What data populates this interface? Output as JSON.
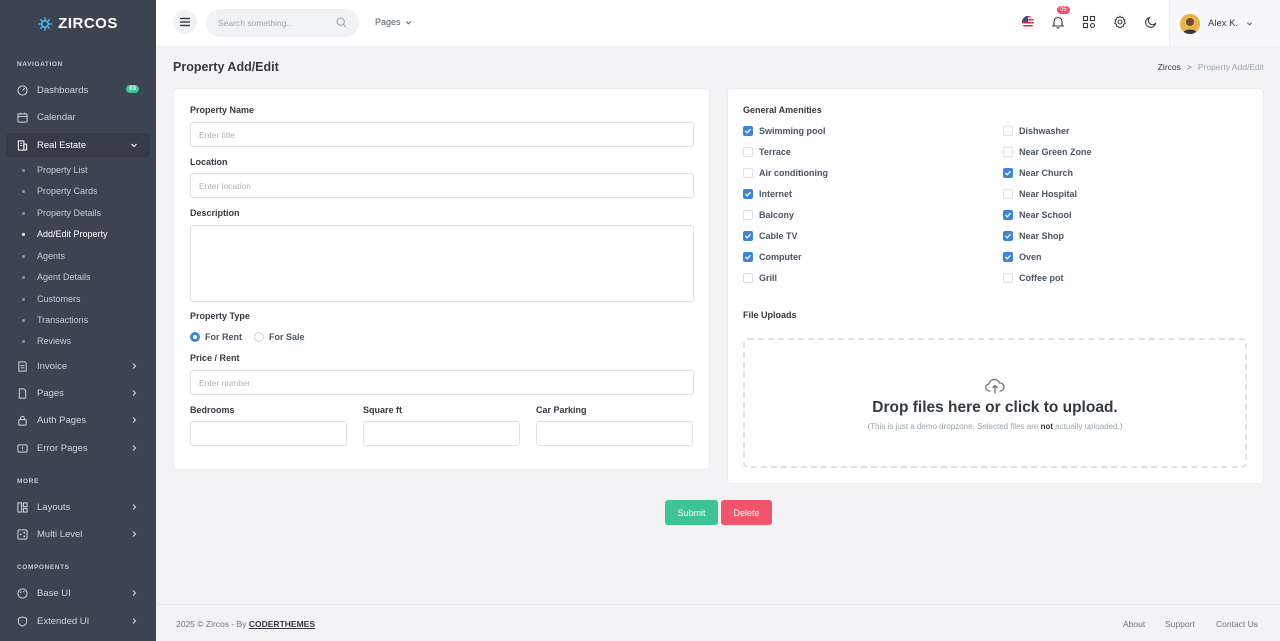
{
  "brand": {
    "name": "ZIRCOS"
  },
  "sidebar": {
    "sections": {
      "navigation": "NAVIGATION",
      "more": "MORE",
      "components": "COMPONENTS"
    },
    "dashboards": {
      "label": "Dashboards",
      "badge": "03"
    },
    "calendar": {
      "label": "Calendar"
    },
    "real_estate": {
      "label": "Real Estate",
      "children": [
        "Property List",
        "Property Cards",
        "Property Details",
        "Add/Edit Property",
        "Agents",
        "Agent Details",
        "Customers",
        "Transactions",
        "Reviews"
      ],
      "current": "Add/Edit Property"
    },
    "invoice": {
      "label": "Invoice"
    },
    "pages": {
      "label": "Pages"
    },
    "auth_pages": {
      "label": "Auth Pages"
    },
    "error_pages": {
      "label": "Error Pages"
    },
    "layouts": {
      "label": "Layouts"
    },
    "multi_level": {
      "label": "Multi Level"
    },
    "base_ui": {
      "label": "Base UI"
    },
    "extended_ui": {
      "label": "Extended UI"
    }
  },
  "topbar": {
    "search_placeholder": "Search something..",
    "pages_label": "Pages",
    "notifications_count": "05",
    "user_name": "Alex K."
  },
  "page": {
    "title": "Property Add/Edit",
    "breadcrumb": {
      "root": "Zircos",
      "separator": ">",
      "current": "Property Add/Edit"
    }
  },
  "form": {
    "property_name": {
      "label": "Property Name",
      "placeholder": "Enter title"
    },
    "location": {
      "label": "Location",
      "placeholder": "Enter location"
    },
    "description": {
      "label": "Description"
    },
    "property_type": {
      "label": "Property Type",
      "options": [
        "For Rent",
        "For Sale"
      ],
      "selected": "For Rent"
    },
    "price": {
      "label": "Price / Rent",
      "placeholder": "Enter number"
    },
    "bedrooms": {
      "label": "Bedrooms"
    },
    "square_ft": {
      "label": "Square ft"
    },
    "car_parking": {
      "label": "Car Parking"
    }
  },
  "amenities": {
    "title": "General Amenities",
    "left": [
      {
        "label": "Swimming pool",
        "checked": true
      },
      {
        "label": "Terrace",
        "checked": false
      },
      {
        "label": "Air conditioning",
        "checked": false
      },
      {
        "label": "Internet",
        "checked": true
      },
      {
        "label": "Balcony",
        "checked": false
      },
      {
        "label": "Cable TV",
        "checked": true
      },
      {
        "label": "Computer",
        "checked": true
      },
      {
        "label": "Grill",
        "checked": false
      }
    ],
    "right": [
      {
        "label": "Dishwasher",
        "checked": false
      },
      {
        "label": "Near Green Zone",
        "checked": false
      },
      {
        "label": "Near Church",
        "checked": true
      },
      {
        "label": "Near Hospital",
        "checked": false
      },
      {
        "label": "Near School",
        "checked": true
      },
      {
        "label": "Near Shop",
        "checked": true
      },
      {
        "label": "Oven",
        "checked": true
      },
      {
        "label": "Coffee pot",
        "checked": false
      }
    ]
  },
  "uploads": {
    "title": "File Uploads",
    "dropzone_title": "Drop files here or click to upload.",
    "note_before": "(This is just a demo dropzone. Selected files are ",
    "note_bold": "not",
    "note_after": " actually uploaded.)"
  },
  "actions": {
    "submit": "Submit",
    "delete": "Delete"
  },
  "footer": {
    "copyright": "2025 © Zircos - By ",
    "author": "CODERTHEMES",
    "links": [
      "About",
      "Support",
      "Contact Us"
    ]
  },
  "colors": {
    "sidebar": "#3c4452",
    "primary": "#3c86d8",
    "success": "#3ec396",
    "danger": "#f1556c"
  }
}
